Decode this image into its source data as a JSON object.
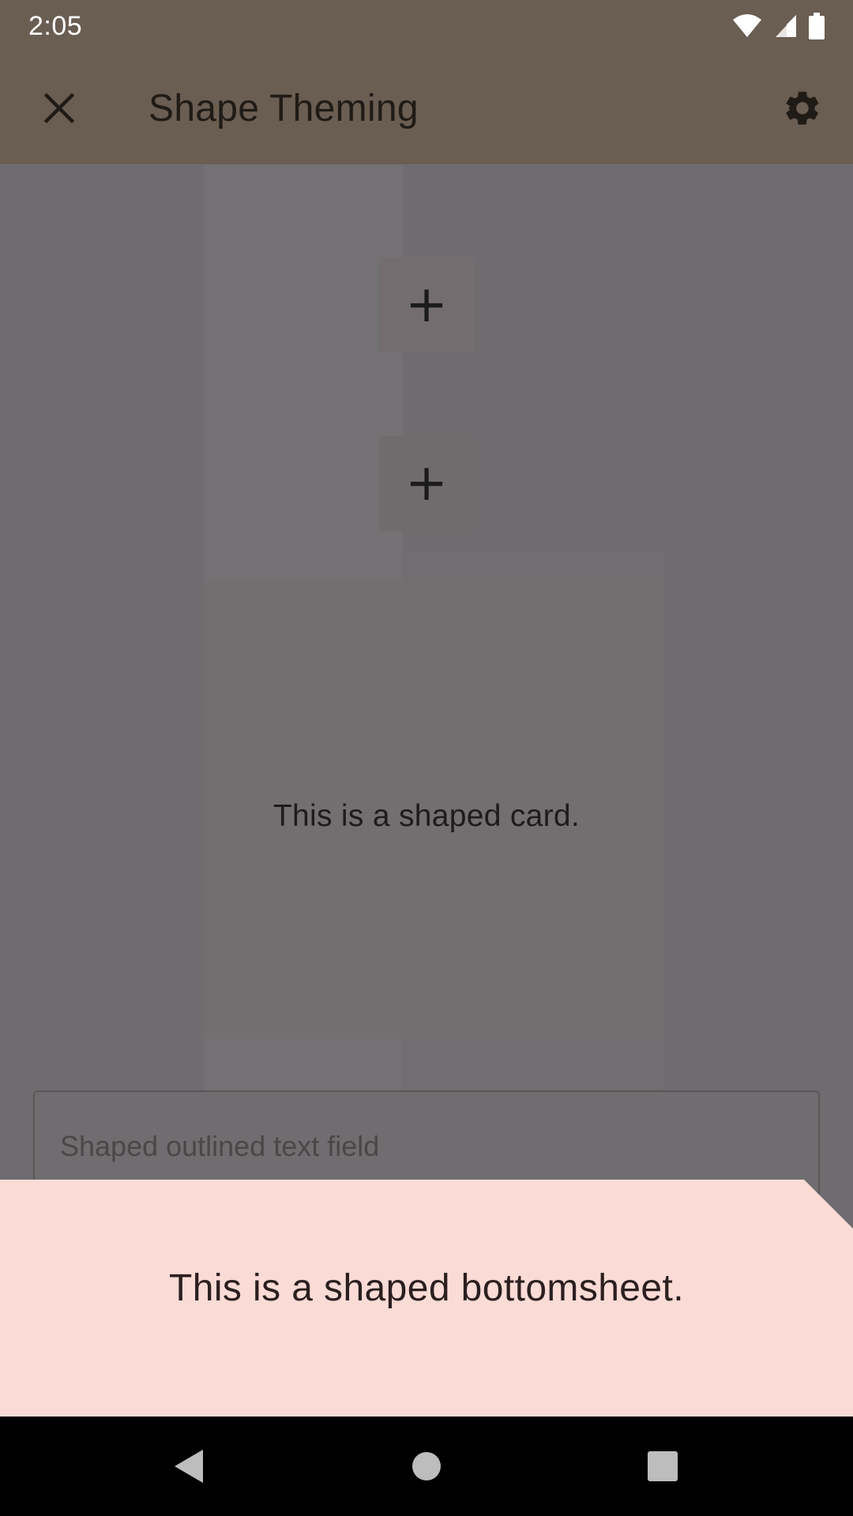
{
  "status_bar": {
    "time": "2:05",
    "icons": [
      "wifi-icon",
      "signal-icon",
      "battery-icon"
    ]
  },
  "toolbar": {
    "title": "Shape Theming",
    "close_icon": "close-icon",
    "settings_icon": "settings-icon"
  },
  "content": {
    "fab_icons": [
      "plus-icon",
      "plus-icon"
    ],
    "fab_glyph": "+",
    "card_text": "This is a shaped card.",
    "text_field": {
      "label": "Shaped outlined text field"
    }
  },
  "bottom_sheet": {
    "text": "This is a shaped bottomsheet.",
    "color": "#fadbd5"
  },
  "nav_bar": {
    "buttons": [
      "back-icon",
      "home-icon",
      "recents-icon"
    ]
  },
  "colors": {
    "toolbar_bg": "#6a5d51",
    "scrim": "#6e6c6f"
  }
}
